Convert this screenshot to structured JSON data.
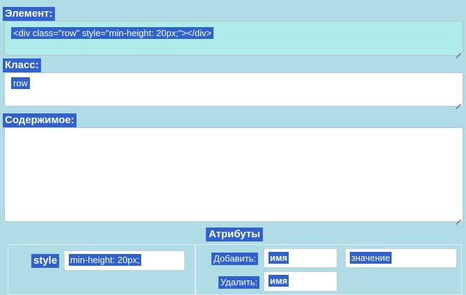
{
  "element": {
    "label": "Элемент:",
    "value": "<div class=\"row\" style=\"min-height: 20px;\"></div>"
  },
  "class": {
    "label": "Класс:",
    "value": "row"
  },
  "content": {
    "label": "Содержимое:",
    "value": ""
  },
  "attributes": {
    "title": "Атрибуты",
    "style_label": "style",
    "style_value": "min-height: 20px;",
    "add_label": "Добавить:",
    "add_name": "имя",
    "add_value": "значение",
    "remove_label": "Удалить:",
    "remove_name": "имя"
  },
  "colors": {
    "background": "#b0dde5",
    "highlight": "#2f62cf",
    "element_field_bg": "#aeecec"
  }
}
